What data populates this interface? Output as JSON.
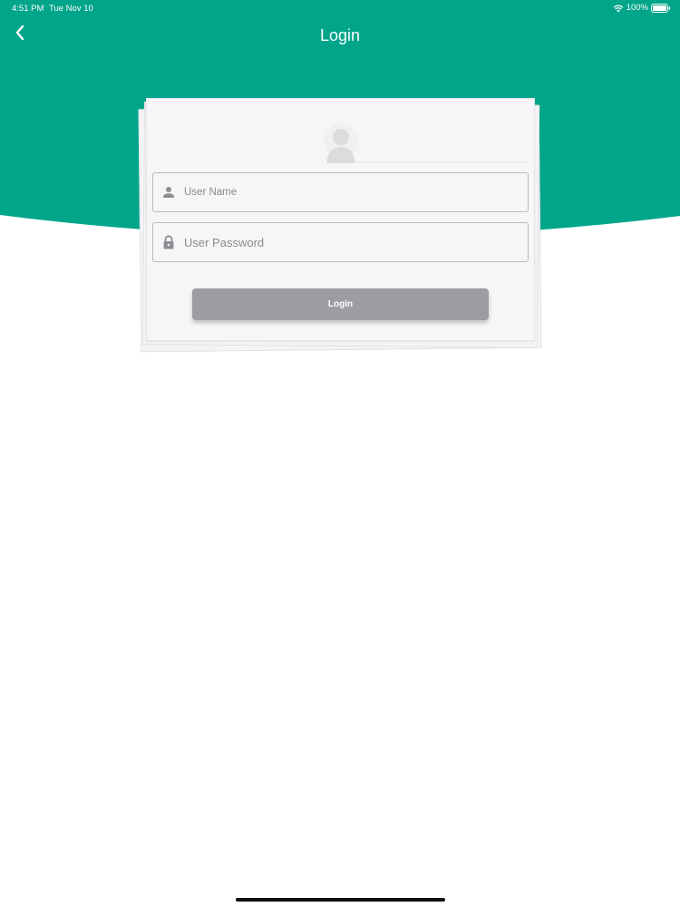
{
  "colors": {
    "header": "#00a58a",
    "card": "#f6f6f8",
    "button": "#9d9ca1"
  },
  "status_bar": {
    "time": "4:51 PM",
    "date": "Tue Nov 10",
    "battery": "100%",
    "icons": [
      "wifi-icon",
      "battery-icon"
    ]
  },
  "nav": {
    "title": "Login",
    "back_icon": "chevron-left-icon"
  },
  "form": {
    "avatar_icon": "user-avatar-icon",
    "username": {
      "placeholder": "User Name",
      "value": "",
      "icon": "user-icon"
    },
    "password": {
      "placeholder": "User Password",
      "value": "",
      "icon": "lock-icon"
    },
    "login_label": "Login"
  }
}
